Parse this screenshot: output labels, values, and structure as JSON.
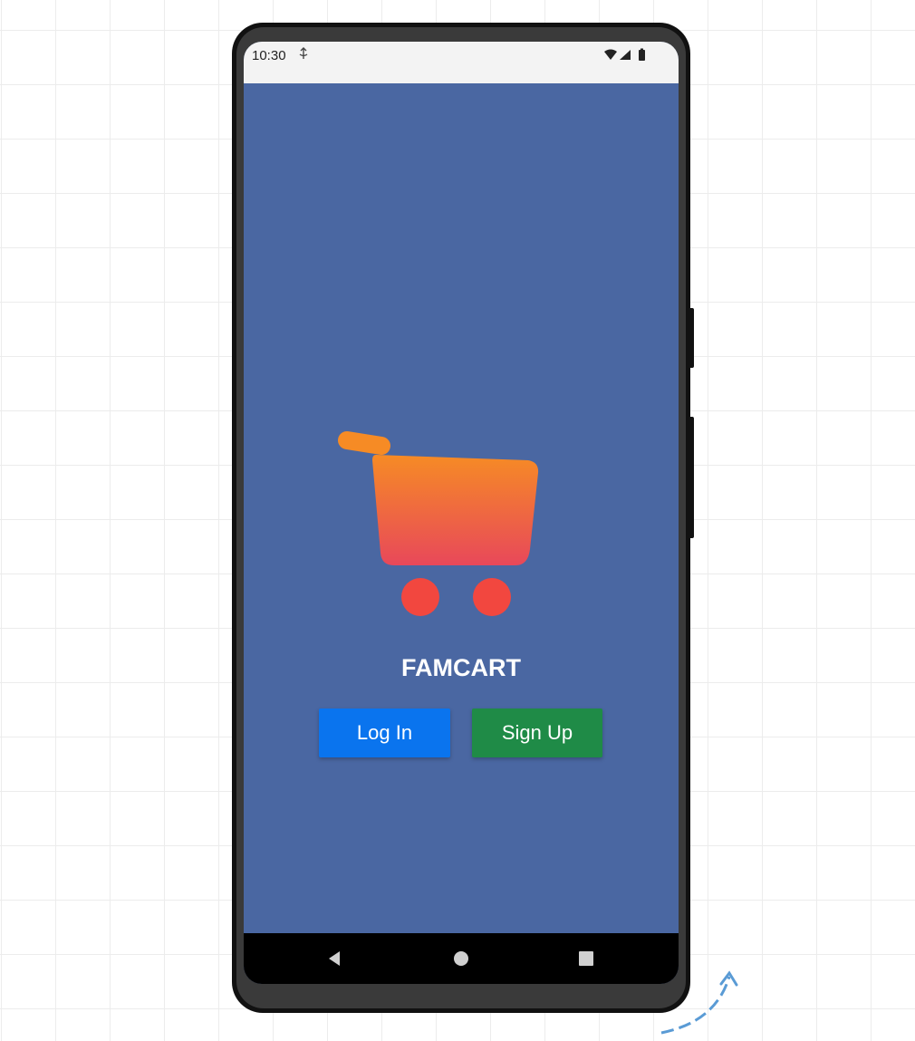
{
  "status_bar": {
    "time": "10:30",
    "icons": [
      "wifi-icon",
      "signal-icon",
      "battery-icon"
    ]
  },
  "app": {
    "title": "FAMCART",
    "logo_icon": "shopping-cart-icon",
    "login_label": "Log In",
    "signup_label": "Sign Up"
  },
  "nav_bar": {
    "icons": [
      "back-icon",
      "home-icon",
      "recents-icon"
    ]
  },
  "colors": {
    "background": "#4a67a2",
    "login_button": "#0a74ee",
    "signup_button": "#1f8b47",
    "cart_gradient_top": "#f68b25",
    "cart_gradient_bottom": "#e8485a",
    "cart_wheels": "#f2473f"
  }
}
